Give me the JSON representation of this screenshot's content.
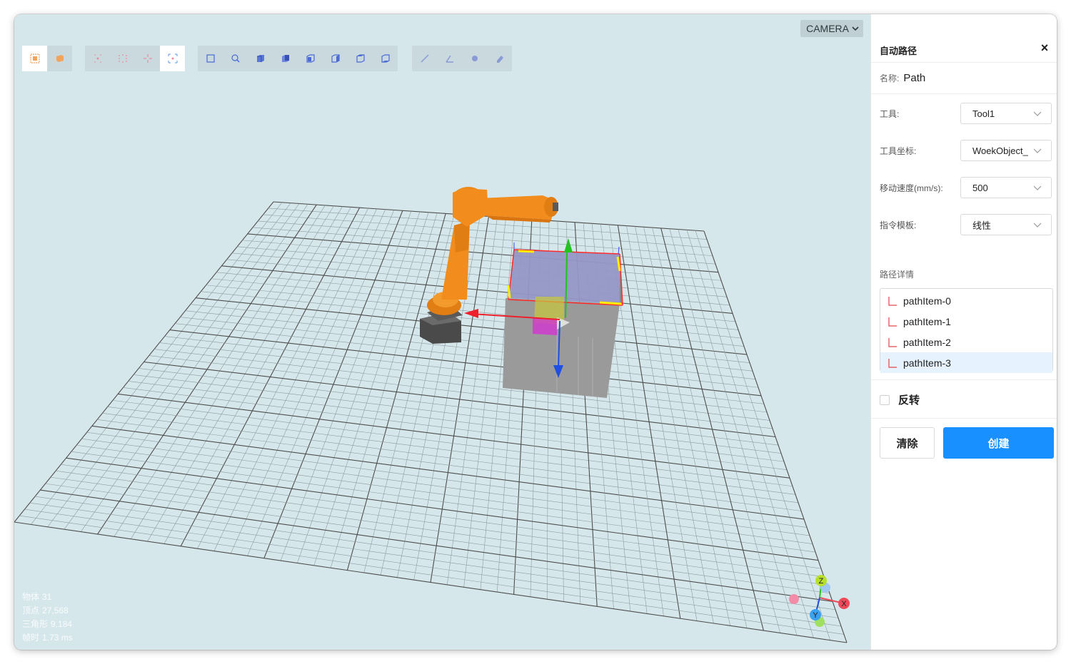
{
  "viewport": {
    "camera_label": "CAMERA",
    "stats": [
      {
        "label": "物体",
        "value": "31"
      },
      {
        "label": "顶点",
        "value": "27,568"
      },
      {
        "label": "三角形",
        "value": "9,184"
      },
      {
        "label": "帧时",
        "value": "1.73 ms"
      }
    ],
    "axis_labels": {
      "z": "Z",
      "x": "X",
      "y": "Y"
    },
    "toolbar_icons": [
      "select-object-icon",
      "solid-box-icon",
      "snap-point-icon",
      "snap-grid-icon",
      "snap-center-icon",
      "snap-frame-icon",
      "view-frame-icon",
      "view-rotate-icon",
      "view-front-icon",
      "view-back-icon",
      "view-left-icon",
      "view-right-icon",
      "view-top-icon",
      "view-bottom-icon",
      "measure-line-icon",
      "measure-angle-icon",
      "point-icon",
      "eraser-icon"
    ]
  },
  "panel": {
    "title": "自动路径",
    "close": "×",
    "name_label": "名称:",
    "name_value": "Path",
    "fields": [
      {
        "label": "工具:",
        "value": "Tool1"
      },
      {
        "label": "工具坐标:",
        "value": "WoekObject_"
      },
      {
        "label": "移动速度(mm/s):",
        "value": "500"
      },
      {
        "label": "指令模板:",
        "value": "线性"
      }
    ],
    "path_section_label": "路径详情",
    "path_items": [
      "pathItem-0",
      "pathItem-1",
      "pathItem-2",
      "pathItem-3"
    ],
    "selected_path_index": 3,
    "reverse_label": "反转",
    "reverse_checked": false,
    "clear_label": "清除",
    "create_label": "创建"
  },
  "colors": {
    "viewport_bg": "#d6e7ec",
    "robot": "#f28c1c",
    "primary": "#1890ff",
    "axis_x": "#ee1f2a",
    "axis_y": "#1f4fe0",
    "axis_z": "#22c21f"
  }
}
